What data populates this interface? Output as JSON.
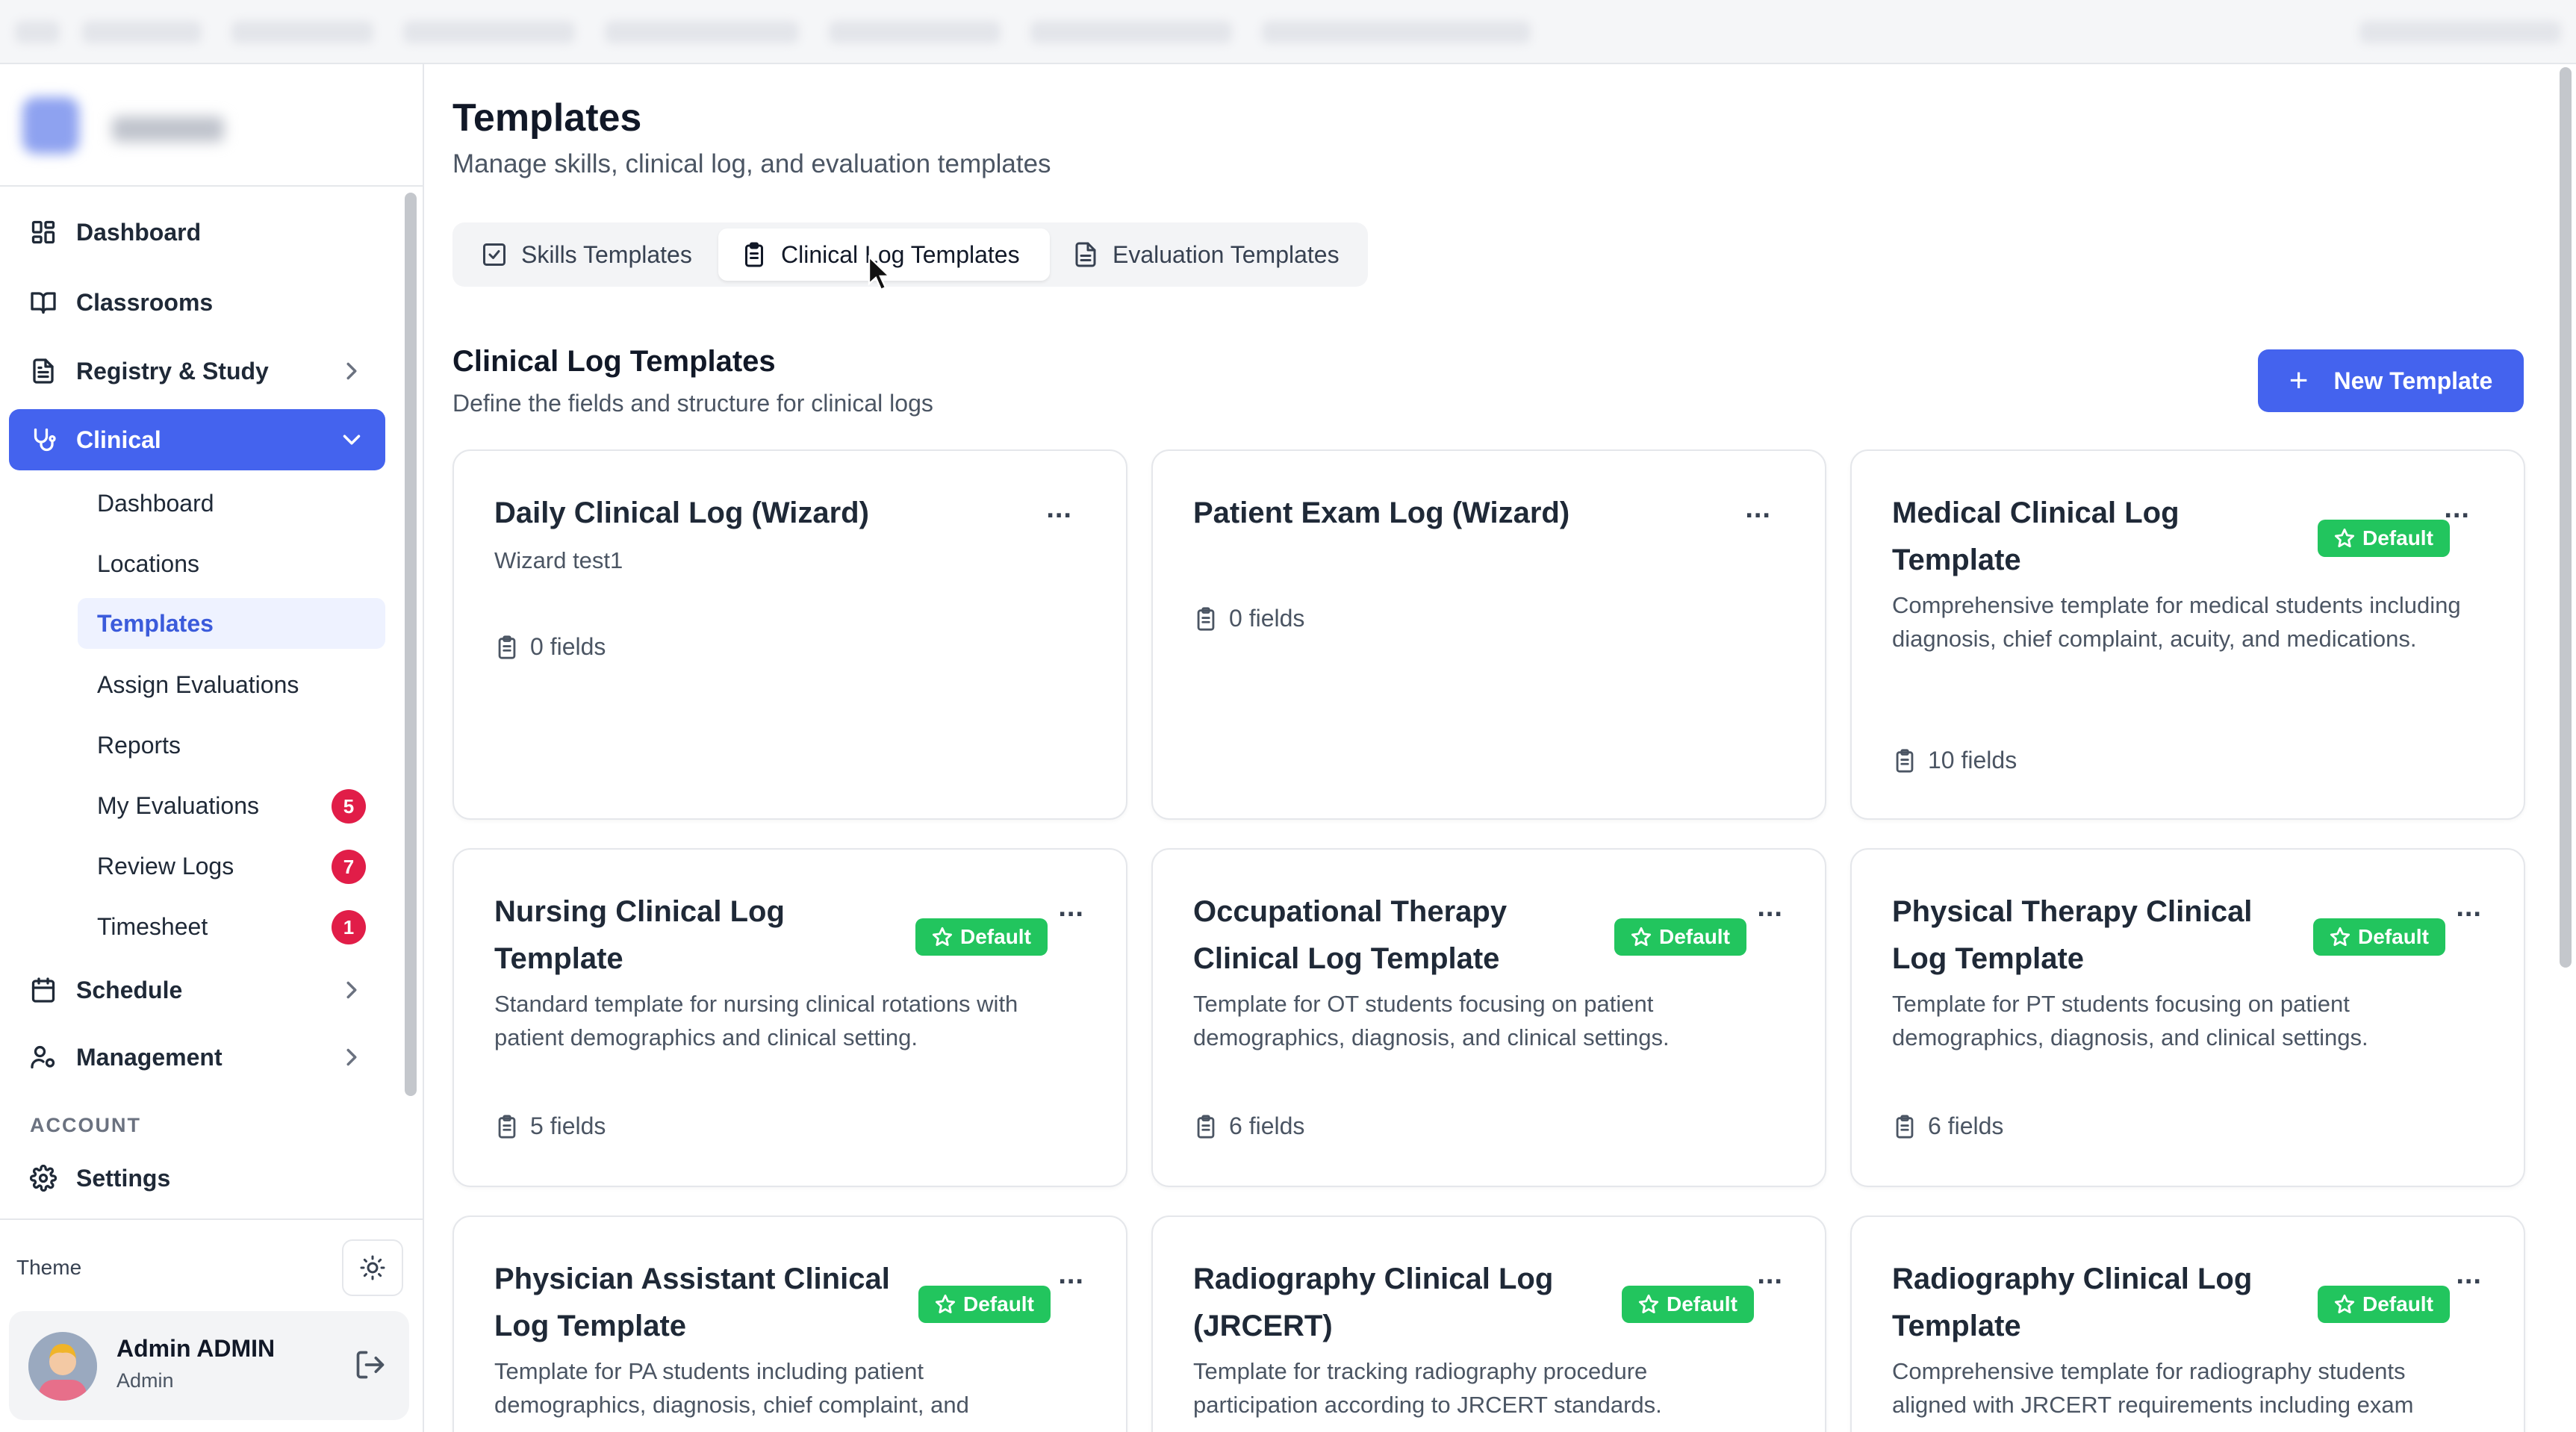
{
  "sidebar": {
    "nav": [
      {
        "label": "Dashboard"
      },
      {
        "label": "Classrooms"
      },
      {
        "label": "Registry & Study"
      },
      {
        "label": "Clinical"
      }
    ],
    "clinical_sub": [
      {
        "label": "Dashboard"
      },
      {
        "label": "Locations"
      },
      {
        "label": "Templates"
      },
      {
        "label": "Assign Evaluations"
      },
      {
        "label": "Reports"
      },
      {
        "label": "My Evaluations",
        "badge": "5"
      },
      {
        "label": "Review Logs",
        "badge": "7"
      },
      {
        "label": "Timesheet",
        "badge": "1"
      }
    ],
    "nav_after": [
      {
        "label": "Schedule"
      },
      {
        "label": "Management"
      }
    ],
    "account_label": "ACCOUNT",
    "settings_label": "Settings",
    "theme_label": "Theme",
    "user": {
      "name": "Admin ADMIN",
      "role": "Admin"
    }
  },
  "header": {
    "title": "Templates",
    "subtitle": "Manage skills, clinical log, and evaluation templates"
  },
  "tabs": [
    {
      "label": "Skills Templates"
    },
    {
      "label": "Clinical Log Templates"
    },
    {
      "label": "Evaluation Templates"
    }
  ],
  "section": {
    "title": "Clinical Log Templates",
    "subtitle": "Define the fields and structure for clinical logs",
    "new_button": "New Template"
  },
  "default_label": "Default",
  "more_label": "...",
  "cards": [
    {
      "title": "Daily Clinical Log (Wizard)",
      "desc": "Wizard test1",
      "fields": "0 fields"
    },
    {
      "title": "Patient Exam Log (Wizard)",
      "desc": "",
      "fields": "0 fields"
    },
    {
      "title": "Medical Clinical Log Template",
      "desc": "Comprehensive template for medical students including diagnosis, chief complaint, acuity, and medications.",
      "fields": "10 fields"
    },
    {
      "title": "Nursing Clinical Log Template",
      "desc": "Standard template for nursing clinical rotations with patient demographics and clinical setting.",
      "fields": "5 fields"
    },
    {
      "title": "Occupational Therapy Clinical Log Template",
      "desc": "Template for OT students focusing on patient demographics, diagnosis, and clinical settings.",
      "fields": "6 fields"
    },
    {
      "title": "Physical Therapy Clinical Log Template",
      "desc": "Template for PT students focusing on patient demographics, diagnosis, and clinical settings.",
      "fields": "6 fields"
    },
    {
      "title": "Physician Assistant Clinical Log Template",
      "desc": "Template for PA students including patient demographics, diagnosis, chief complaint, and",
      "fields": ""
    },
    {
      "title": "Radiography Clinical Log (JRCERT)",
      "desc": "Template for tracking radiography procedure participation according to JRCERT standards.",
      "fields": ""
    },
    {
      "title": "Radiography Clinical Log Template",
      "desc": "Comprehensive template for radiography students aligned with JRCERT requirements including exam",
      "fields": ""
    }
  ],
  "colors": {
    "accent": "#4463ee",
    "default_badge": "#22c55e",
    "count_badge": "#e11d48"
  }
}
